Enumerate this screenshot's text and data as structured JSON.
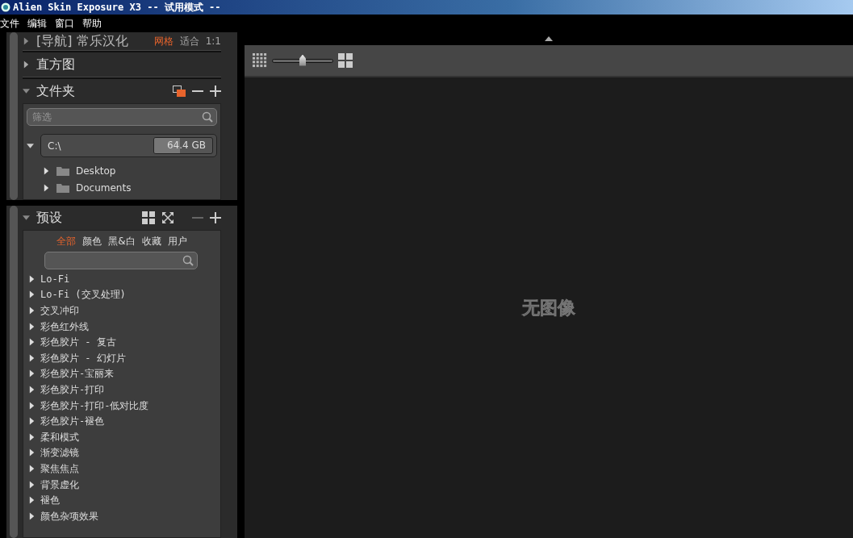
{
  "window": {
    "title": "Alien Skin Exposure X3 -- 试用模式 --"
  },
  "menu": [
    "文件",
    "编辑",
    "窗口",
    "帮助"
  ],
  "navigator": {
    "title": "[导航] 常乐汉化",
    "modes": [
      {
        "label": "网格",
        "selected": true
      },
      {
        "label": "适合",
        "selected": false
      },
      {
        "label": "1:1",
        "selected": false
      }
    ],
    "expanded": false
  },
  "histogram": {
    "title": "直方图",
    "expanded": false
  },
  "folders": {
    "title": "文件夹",
    "expanded": true,
    "filter": {
      "placeholder": "筛选"
    },
    "drive": {
      "name": "C:\\",
      "free": "64.4 GB",
      "level": 0.45,
      "expanded": true
    },
    "items": [
      {
        "name": "Desktop",
        "expanded": false
      },
      {
        "name": "Documents",
        "expanded": false
      }
    ]
  },
  "presets": {
    "title": "预设",
    "expanded": true,
    "tabs": [
      {
        "label": "全部",
        "selected": true
      },
      {
        "label": "颜色",
        "selected": false
      },
      {
        "label": "黑&白",
        "selected": false
      },
      {
        "label": "收藏",
        "selected": false
      },
      {
        "label": "用户",
        "selected": false
      }
    ],
    "items": [
      "Lo-Fi",
      "Lo-Fi (交叉处理)",
      "交叉冲印",
      "彩色红外线",
      "彩色胶片 - 复古",
      "彩色胶片 - 幻灯片",
      "彩色胶片-宝丽来",
      "彩色胶片-打印",
      "彩色胶片-打印-低对比度",
      "彩色胶片-褪色",
      "柔和模式",
      "渐变滤镜",
      "聚焦焦点",
      "背景虚化",
      "褪色",
      "颜色杂项效果"
    ]
  },
  "viewer": {
    "thumb_size": {
      "level": 0.5
    },
    "empty_text": "无图像"
  }
}
